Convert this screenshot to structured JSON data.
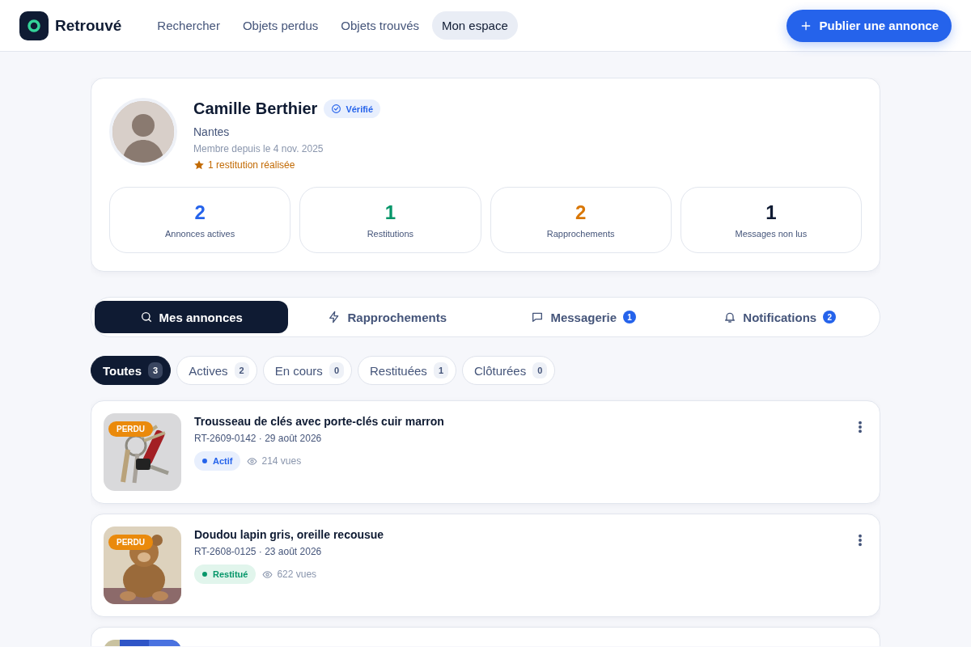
{
  "header": {
    "brand": "Retrouvé",
    "nav": [
      {
        "label": "Rechercher",
        "selected": false
      },
      {
        "label": "Objets perdus",
        "selected": false
      },
      {
        "label": "Objets trouvés",
        "selected": false
      },
      {
        "label": "Mon espace",
        "selected": true
      }
    ],
    "publish_button": "Publier une annonce"
  },
  "profile": {
    "name": "Camille Berthier",
    "verified_badge": "Vérifié",
    "city": "Nantes",
    "member_since": "Membre depuis le 4 nov. 2025",
    "restitutions": "1 restitution réalisée",
    "stats": [
      {
        "value": "2",
        "label": "Annonces actives",
        "color": "#2563eb"
      },
      {
        "value": "1",
        "label": "Restitutions",
        "color": "#059669"
      },
      {
        "value": "2",
        "label": "Rapprochements",
        "color": "#d97706"
      },
      {
        "value": "1",
        "label": "Messages non lus",
        "color": "#0f1b33"
      }
    ]
  },
  "tabs": [
    {
      "kind": "search",
      "label": "Mes annonces",
      "selected": true
    },
    {
      "kind": "matches",
      "label": "Rapprochements",
      "selected": false
    },
    {
      "kind": "messages",
      "label": "Messagerie",
      "badge": "1",
      "selected": false
    },
    {
      "kind": "notifications",
      "label": "Notifications",
      "badge": "2",
      "selected": false
    }
  ],
  "filters": [
    {
      "label": "Toutes",
      "count": "3",
      "selected": true
    },
    {
      "label": "Actives",
      "count": "2",
      "selected": false
    },
    {
      "label": "En cours",
      "count": "0",
      "selected": false
    },
    {
      "label": "Restituées",
      "count": "1",
      "selected": false
    },
    {
      "label": "Clôturées",
      "count": "0",
      "selected": false
    }
  ],
  "listings": [
    {
      "kind": "full",
      "tag": "PERDU",
      "title": "Trousseau de clés avec porte-clés cuir marron",
      "ref": "RT-2609-0142 · 29 août 2026",
      "status": {
        "kind": "active",
        "label": "Actif"
      },
      "views": "214 vues"
    },
    {
      "kind": "full",
      "tag": "PERDU",
      "title": "Doudou lapin gris, oreille recousue",
      "ref": "RT-2608-0125 · 23 août 2026",
      "status": {
        "kind": "returned",
        "label": "Restitué"
      },
      "views": "622 vues"
    },
    {
      "kind": "cut"
    }
  ]
}
